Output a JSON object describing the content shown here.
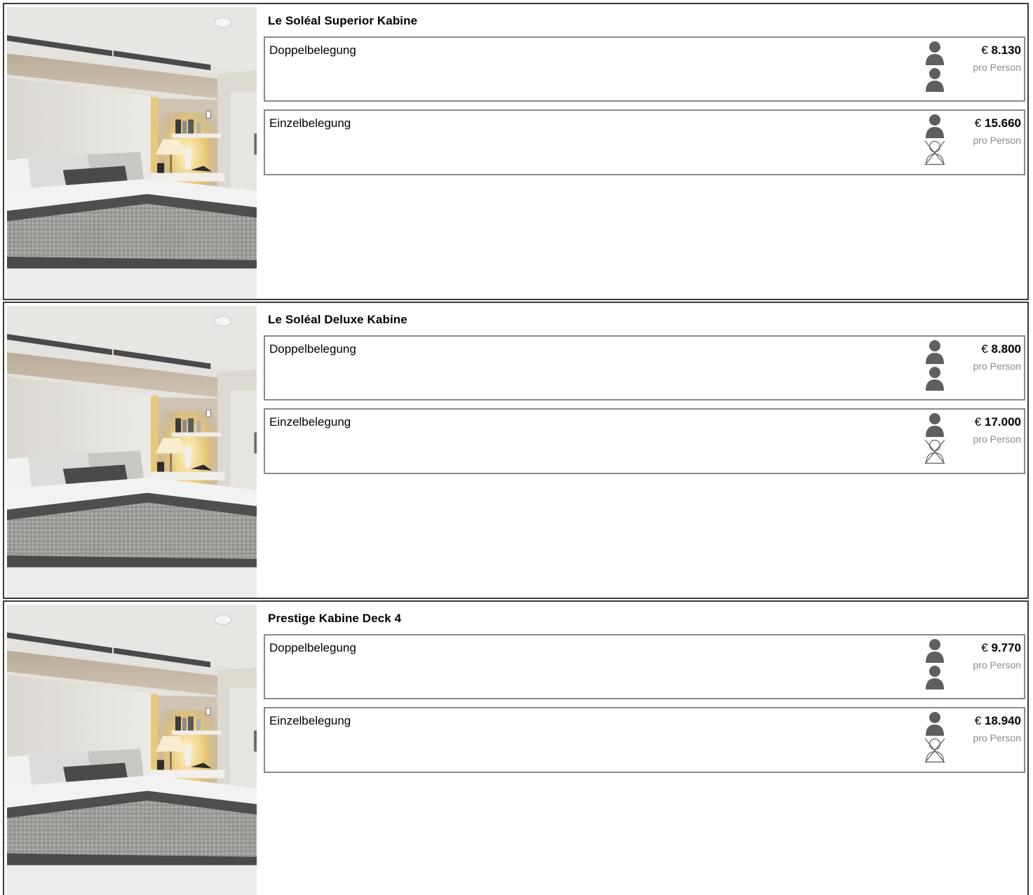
{
  "colors": {
    "border_outer": "#3a3a3a",
    "border_inner": "#8a8a8a",
    "icon": "#5f5f5f",
    "muted_text": "#8a8a8a"
  },
  "icons": {
    "person": "person-icon",
    "no_person": "no-person-icon"
  },
  "cabins": [
    {
      "title": "Le Soléal Superior Kabine",
      "photo": "cabin-photo",
      "options": [
        {
          "label": "Doppelbelegung",
          "currency": "€",
          "price": "8.130",
          "unit": "pro Person",
          "persons": 2
        },
        {
          "label": "Einzelbelegung",
          "currency": "€",
          "price": "15.660",
          "unit": "pro Person",
          "persons": 1
        }
      ]
    },
    {
      "title": "Le Soléal Deluxe Kabine",
      "photo": "cabin-photo",
      "options": [
        {
          "label": "Doppelbelegung",
          "currency": "€",
          "price": "8.800",
          "unit": "pro Person",
          "persons": 2
        },
        {
          "label": "Einzelbelegung",
          "currency": "€",
          "price": "17.000",
          "unit": "pro Person",
          "persons": 1
        }
      ]
    },
    {
      "title": "Prestige Kabine Deck 4",
      "photo": "cabin-photo",
      "options": [
        {
          "label": "Doppelbelegung",
          "currency": "€",
          "price": "9.770",
          "unit": "pro Person",
          "persons": 2
        },
        {
          "label": "Einzelbelegung",
          "currency": "€",
          "price": "18.940",
          "unit": "pro Person",
          "persons": 1
        }
      ]
    }
  ]
}
